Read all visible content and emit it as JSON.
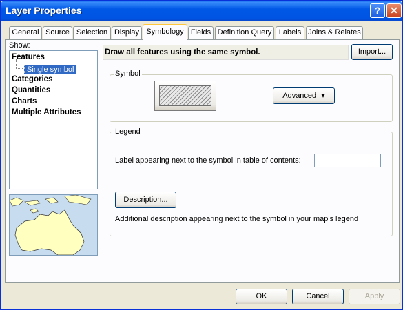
{
  "window": {
    "title": "Layer Properties",
    "help_glyph": "?",
    "close_glyph": "✕"
  },
  "tabs": [
    {
      "label": "General"
    },
    {
      "label": "Source"
    },
    {
      "label": "Selection"
    },
    {
      "label": "Display"
    },
    {
      "label": "Symbology",
      "active": true
    },
    {
      "label": "Fields"
    },
    {
      "label": "Definition Query"
    },
    {
      "label": "Labels"
    },
    {
      "label": "Joins & Relates"
    }
  ],
  "show": {
    "label": "Show:",
    "items": [
      {
        "label": "Features"
      },
      {
        "label": "Single symbol",
        "selected": true
      },
      {
        "label": "Categories"
      },
      {
        "label": "Quantities"
      },
      {
        "label": "Charts"
      },
      {
        "label": "Multiple Attributes"
      }
    ]
  },
  "header": {
    "text": "Draw all features using the same symbol.",
    "import_label": "Import..."
  },
  "symbol": {
    "title": "Symbol",
    "advanced_label": "Advanced",
    "advanced_arrow": "▾"
  },
  "legend": {
    "title": "Legend",
    "label_text": "Label appearing next to the symbol in table of contents:",
    "label_value": "",
    "description_button": "Description...",
    "description_text": "Additional description appearing next to the symbol in your map's legend"
  },
  "footer": {
    "ok": "OK",
    "cancel": "Cancel",
    "apply": "Apply",
    "apply_enabled": false
  },
  "colors": {
    "titlebar": "#0054e3",
    "selection": "#316ac5",
    "tab_highlight": "#ffc83c",
    "map_land": "#ffffc0",
    "map_water": "#c8dcf0"
  }
}
